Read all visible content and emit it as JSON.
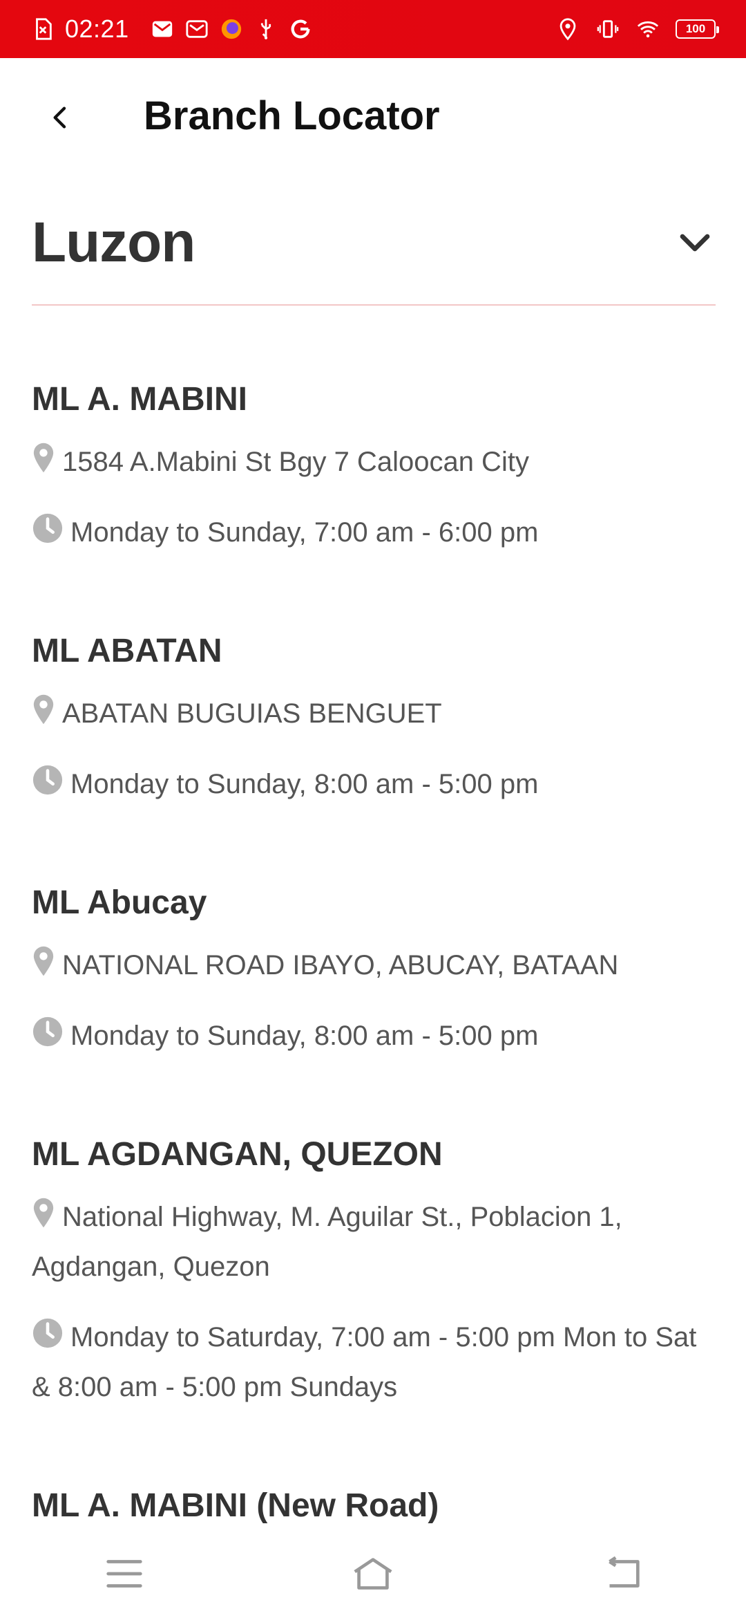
{
  "status_bar": {
    "time": "02:21",
    "battery": "100",
    "colors": {
      "background": "#e4070f",
      "foreground": "#ffffff"
    }
  },
  "app_bar": {
    "title": "Branch Locator",
    "back_icon": "back-arrow-icon"
  },
  "region_select": {
    "selected": "Luzon",
    "icon": "chevron-down-icon",
    "divider_color": "#f3c6c6"
  },
  "branches": [
    {
      "name": "ML A. MABINI",
      "address": "1584 A.Mabini St Bgy 7 Caloocan City",
      "hours": "Monday to Sunday, 7:00 am - 6:00 pm"
    },
    {
      "name": "ML ABATAN",
      "address": "ABATAN BUGUIAS BENGUET",
      "hours": "Monday to Sunday, 8:00 am - 5:00 pm"
    },
    {
      "name": "ML Abucay",
      "address": "NATIONAL ROAD IBAYO, ABUCAY, BATAAN",
      "hours": "Monday to Sunday, 8:00 am - 5:00 pm"
    },
    {
      "name": "ML AGDANGAN, QUEZON",
      "address": "National Highway, M. Aguilar St., Poblacion 1, Agdangan, Quezon",
      "hours": "Monday to Saturday, 7:00 am - 5:00 pm Mon to Sat & 8:00 am - 5:00 pm Sundays"
    },
    {
      "name": "ML A. MABINI (New Road)"
    }
  ],
  "nav_bar": {
    "items": [
      "menu-icon",
      "home-icon",
      "back-icon"
    ]
  }
}
